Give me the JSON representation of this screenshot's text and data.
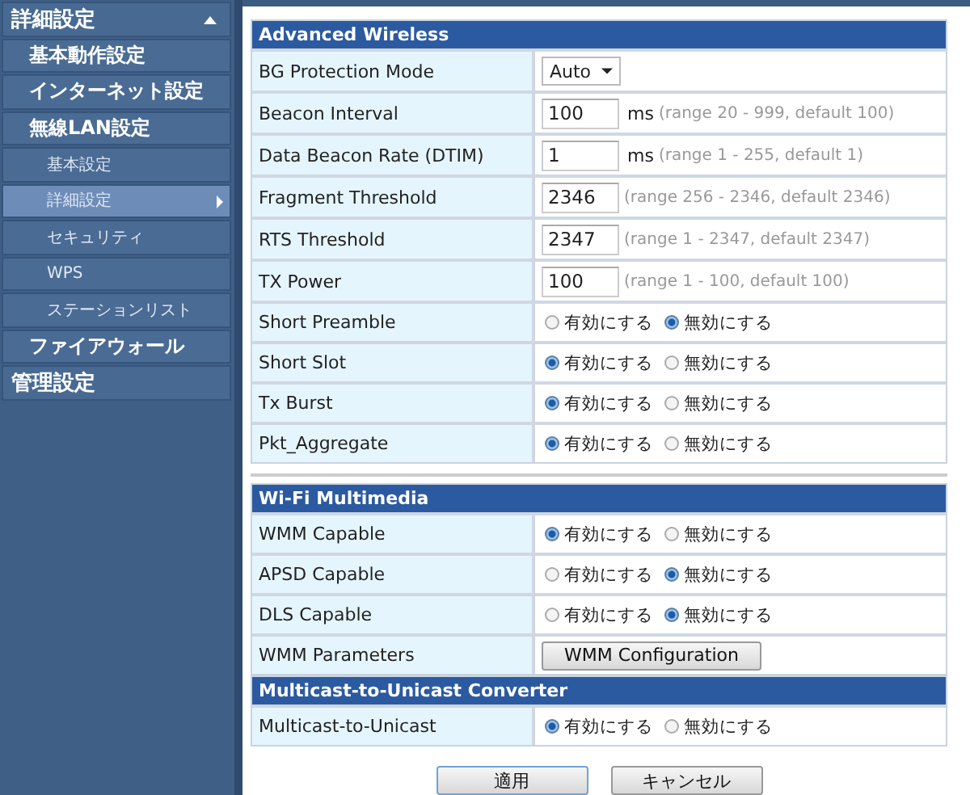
{
  "sidebar": {
    "items": [
      {
        "label": "詳細設定",
        "expanded": true,
        "selected": false,
        "children": [
          {
            "label": "基本動作設定",
            "selected": false
          },
          {
            "label": "インターネット設定",
            "selected": false
          },
          {
            "label": "無線LAN設定",
            "selected": false,
            "children": [
              {
                "label": "基本設定",
                "selected": false
              },
              {
                "label": "詳細設定",
                "selected": true
              },
              {
                "label": "セキュリティ",
                "selected": false
              },
              {
                "label": "WPS",
                "selected": false
              },
              {
                "label": "ステーションリスト",
                "selected": false
              }
            ]
          },
          {
            "label": "ファイアウォール",
            "selected": false
          }
        ]
      },
      {
        "label": "管理設定",
        "selected": false
      }
    ]
  },
  "sections": [
    {
      "title": "Advanced Wireless",
      "rows": [
        {
          "label": "BG Protection Mode",
          "kind": "select",
          "value": "Auto"
        },
        {
          "label": "Beacon Interval",
          "kind": "input",
          "value": "100",
          "unit": "ms",
          "hint": "(range 20 - 999, default 100)"
        },
        {
          "label": "Data Beacon Rate (DTIM)",
          "kind": "input",
          "value": "1",
          "unit": "ms",
          "hint": "(range 1 - 255, default 1)"
        },
        {
          "label": "Fragment Threshold",
          "kind": "input",
          "value": "2346",
          "hint": "(range 256 - 2346, default 2346)"
        },
        {
          "label": "RTS Threshold",
          "kind": "input",
          "value": "2347",
          "hint": "(range 1 - 2347, default 2347)"
        },
        {
          "label": "TX Power",
          "kind": "input",
          "value": "100",
          "hint": "(range 1 - 100, default 100)"
        },
        {
          "label": "Short Preamble",
          "kind": "radio",
          "options": [
            {
              "label": "有効にする",
              "selected": false
            },
            {
              "label": "無効にする",
              "selected": true
            }
          ]
        },
        {
          "label": "Short Slot",
          "kind": "radio",
          "options": [
            {
              "label": "有効にする",
              "selected": true
            },
            {
              "label": "無効にする",
              "selected": false
            }
          ]
        },
        {
          "label": "Tx Burst",
          "kind": "radio",
          "options": [
            {
              "label": "有効にする",
              "selected": true
            },
            {
              "label": "無効にする",
              "selected": false
            }
          ]
        },
        {
          "label": "Pkt_Aggregate",
          "kind": "radio",
          "options": [
            {
              "label": "有効にする",
              "selected": true
            },
            {
              "label": "無効にする",
              "selected": false
            }
          ]
        }
      ]
    },
    {
      "title": "Wi-Fi Multimedia",
      "rows": [
        {
          "label": "WMM Capable",
          "kind": "radio",
          "options": [
            {
              "label": "有効にする",
              "selected": true
            },
            {
              "label": "無効にする",
              "selected": false
            }
          ]
        },
        {
          "label": "APSD Capable",
          "kind": "radio",
          "options": [
            {
              "label": "有効にする",
              "selected": false
            },
            {
              "label": "無効にする",
              "selected": true
            }
          ]
        },
        {
          "label": "DLS Capable",
          "kind": "radio",
          "options": [
            {
              "label": "有効にする",
              "selected": false
            },
            {
              "label": "無効にする",
              "selected": true
            }
          ]
        },
        {
          "label": "WMM Parameters",
          "kind": "button",
          "value": "WMM Configuration"
        }
      ]
    },
    {
      "title": "Multicast-to-Unicast Converter",
      "rows": [
        {
          "label": "Multicast-to-Unicast",
          "kind": "radio",
          "options": [
            {
              "label": "有効にする",
              "selected": true
            },
            {
              "label": "無効にする",
              "selected": false
            }
          ]
        }
      ]
    }
  ],
  "buttons": [
    "適用",
    "キャンセル"
  ]
}
